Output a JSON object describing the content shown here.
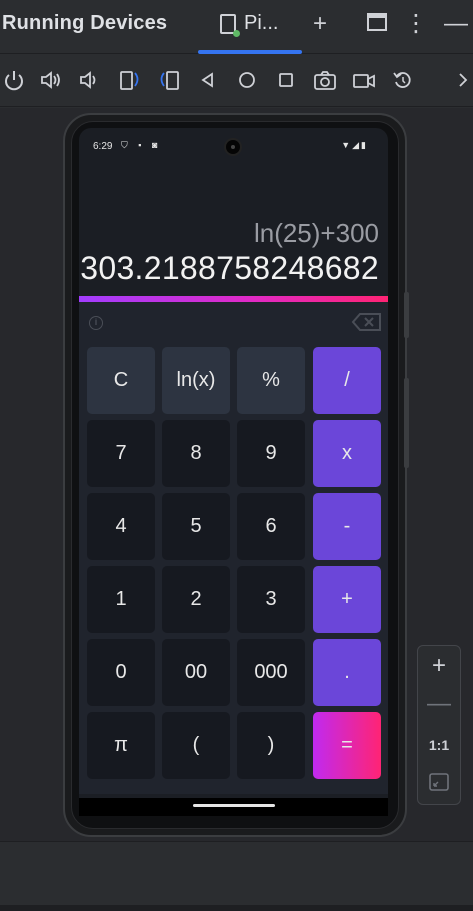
{
  "ide": {
    "title": "Running Devices",
    "tab_label": "Pi...",
    "add_label": "+",
    "more_label": "⋮",
    "minimize_label": "—"
  },
  "toolbar": {
    "icons": [
      "power-icon",
      "volume-up-icon",
      "volume-down-icon",
      "rotate-left-icon",
      "rotate-right-icon",
      "back-icon",
      "home-icon",
      "overview-icon",
      "screenshot-icon",
      "screen-record-icon",
      "reset-icon",
      "more-chevron-icon"
    ]
  },
  "zoom": {
    "zoom_in": "+",
    "zoom_out": "—",
    "actual_size": "1:1"
  },
  "status_bar": {
    "time": "6:29",
    "left_icons": "⛉ ▪ ◙",
    "right_icons": "▼◢▮"
  },
  "calculator": {
    "expression": "ln(25)+300",
    "result": "303.2188758248682",
    "info_icon": "i",
    "accent_start": "#a23dff",
    "accent_end": "#ff2474",
    "operator_color": "#6b46d9",
    "keys": [
      {
        "label": "C",
        "kind": "fn",
        "name": "key-clear"
      },
      {
        "label": "ln(x)",
        "kind": "fn",
        "name": "key-ln"
      },
      {
        "label": "%",
        "kind": "fn",
        "name": "key-percent"
      },
      {
        "label": "/",
        "kind": "op",
        "name": "key-divide"
      },
      {
        "label": "7",
        "kind": "num",
        "name": "key-7"
      },
      {
        "label": "8",
        "kind": "num",
        "name": "key-8"
      },
      {
        "label": "9",
        "kind": "num",
        "name": "key-9"
      },
      {
        "label": "x",
        "kind": "op",
        "name": "key-multiply"
      },
      {
        "label": "4",
        "kind": "num",
        "name": "key-4"
      },
      {
        "label": "5",
        "kind": "num",
        "name": "key-5"
      },
      {
        "label": "6",
        "kind": "num",
        "name": "key-6"
      },
      {
        "label": "-",
        "kind": "op",
        "name": "key-minus"
      },
      {
        "label": "1",
        "kind": "num",
        "name": "key-1"
      },
      {
        "label": "2",
        "kind": "num",
        "name": "key-2"
      },
      {
        "label": "3",
        "kind": "num",
        "name": "key-3"
      },
      {
        "label": "+",
        "kind": "op",
        "name": "key-plus"
      },
      {
        "label": "0",
        "kind": "num",
        "name": "key-0"
      },
      {
        "label": "00",
        "kind": "num",
        "name": "key-00"
      },
      {
        "label": "000",
        "kind": "num",
        "name": "key-000"
      },
      {
        "label": ".",
        "kind": "op",
        "name": "key-decimal"
      },
      {
        "label": "π",
        "kind": "num",
        "name": "key-pi"
      },
      {
        "label": "(",
        "kind": "num",
        "name": "key-open-paren"
      },
      {
        "label": ")",
        "kind": "num",
        "name": "key-close-paren"
      },
      {
        "label": "=",
        "kind": "eq",
        "name": "key-equals"
      }
    ]
  }
}
